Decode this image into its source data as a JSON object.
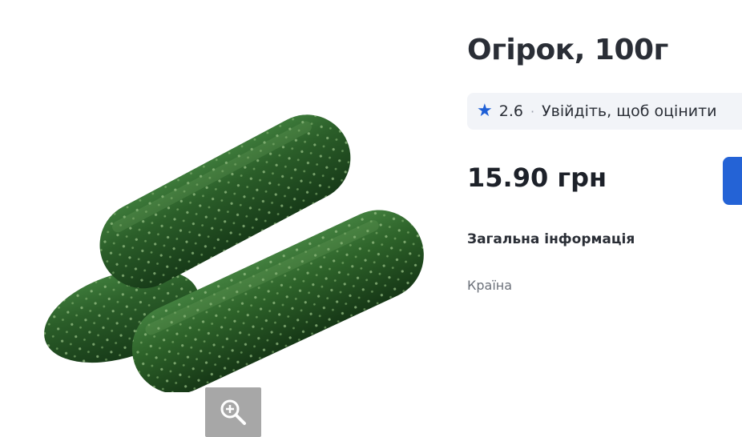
{
  "product": {
    "title": "Огірок, 100г",
    "image_alt": "cucumbers",
    "price": "15.90 грн"
  },
  "rating": {
    "value": "2.6",
    "separator": "·",
    "login_prompt": "Увійдіть, щоб оцінити",
    "star_icon": "star-icon",
    "star_color": "#1e5fd6"
  },
  "details": {
    "section_title": "Загальна інформація",
    "country_label": "Країна"
  },
  "colors": {
    "accent": "#2463d6",
    "zoom_button": "#a7a7a7"
  },
  "icons": {
    "zoom": "zoom-in-icon"
  }
}
